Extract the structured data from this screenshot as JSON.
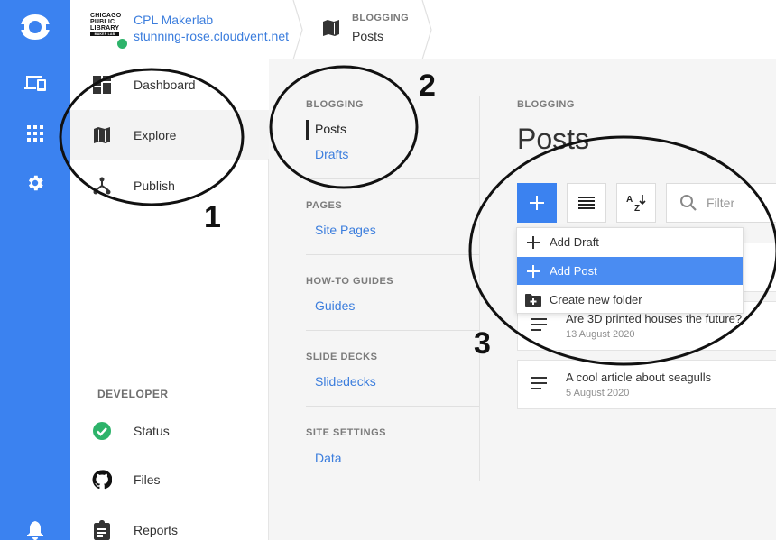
{
  "site": {
    "name": "CPL Makerlab",
    "url": "stunning-rose.cloudvent.net",
    "logo_text": [
      "CHICAGO",
      "PUBLIC",
      "LIBRARY"
    ],
    "logo_bar": "MAKER LAB"
  },
  "breadcrumb": {
    "section": "BLOGGING",
    "page": "Posts"
  },
  "nav": {
    "items": [
      {
        "label": "Dashboard"
      },
      {
        "label": "Explore"
      },
      {
        "label": "Publish"
      }
    ],
    "developer_heading": "DEVELOPER",
    "developer_items": [
      {
        "label": "Status"
      },
      {
        "label": "Files"
      },
      {
        "label": "Reports"
      }
    ]
  },
  "collections": {
    "groups": [
      {
        "heading": "BLOGGING",
        "links": [
          "Posts",
          "Drafts"
        ]
      },
      {
        "heading": "PAGES",
        "links": [
          "Site Pages"
        ]
      },
      {
        "heading": "HOW-TO GUIDES",
        "links": [
          "Guides"
        ]
      },
      {
        "heading": "SLIDE DECKS",
        "links": [
          "Slidedecks"
        ]
      },
      {
        "heading": "SITE SETTINGS",
        "links": [
          "Data"
        ]
      }
    ]
  },
  "content": {
    "section": "BLOGGING",
    "title": "Posts",
    "filter_placeholder": "Filter",
    "add_menu": [
      {
        "label": "Add Draft",
        "icon": "plus-icon"
      },
      {
        "label": "Add Post",
        "icon": "plus-icon",
        "highlighted": true
      },
      {
        "label": "Create new folder",
        "icon": "folder-plus-icon"
      }
    ],
    "posts": [
      {
        "title": "Are 3D printed houses the future?",
        "date": "13 August 2020"
      },
      {
        "title": "A cool article about seagulls",
        "date": "5 August 2020"
      }
    ]
  },
  "annotations": {
    "labels": [
      "1",
      "2",
      "3"
    ]
  },
  "colors": {
    "accent": "#3b82f0",
    "link": "#3b7ddd",
    "status_ok": "#2db36a"
  }
}
